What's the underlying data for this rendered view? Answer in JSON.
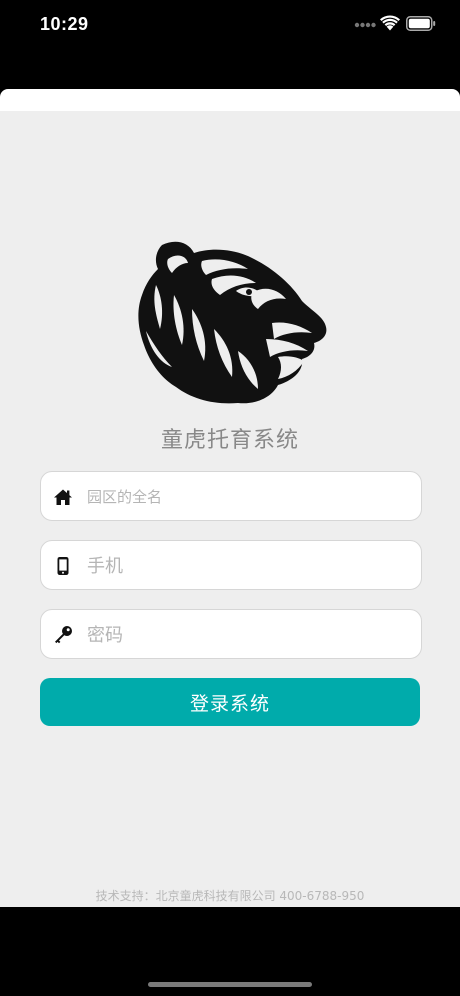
{
  "status_bar": {
    "time": "10:29"
  },
  "app": {
    "title": "童虎托育系统",
    "logo_icon": "tiger-head-logo"
  },
  "form": {
    "park_placeholder": "园区的全名",
    "phone_placeholder": "手机",
    "password_placeholder": "密码",
    "park_icon": "home-icon",
    "phone_icon": "phone-icon",
    "password_icon": "key-icon"
  },
  "login_button": {
    "label": "登录系统",
    "color": "#00abab"
  },
  "footer": {
    "text": "技术支持：北京童虎科技有限公司 400-6788-950"
  }
}
